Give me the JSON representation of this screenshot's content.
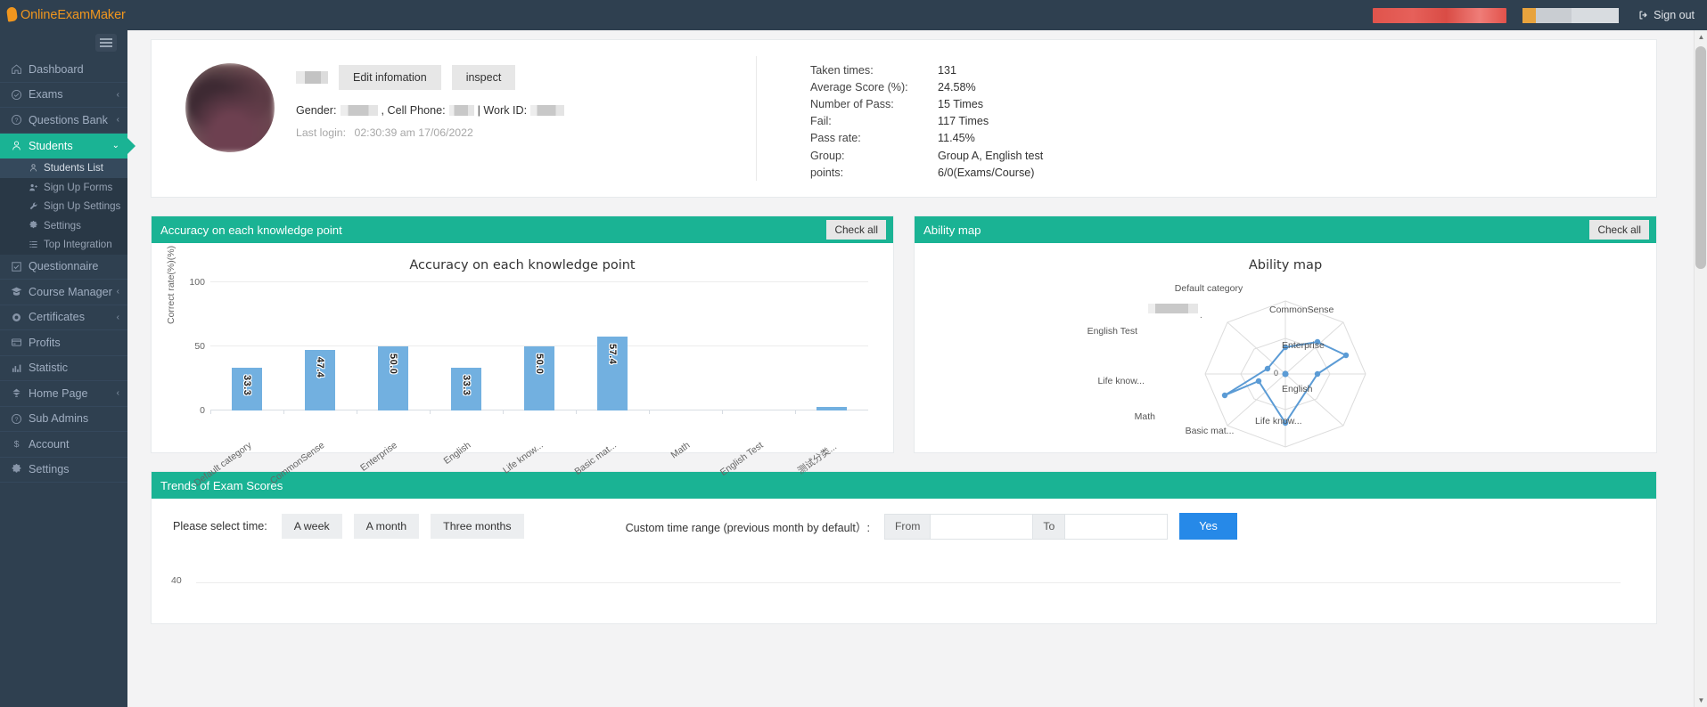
{
  "brand": {
    "name": "OnlineExamMaker"
  },
  "topbar": {
    "sign_out": "Sign out",
    "accent": "#f0961e"
  },
  "sidebar": {
    "items": [
      {
        "label": "Dashboard",
        "icon": "home-icon",
        "chevron": false,
        "active": false
      },
      {
        "label": "Exams",
        "icon": "check-circle-icon",
        "chevron": true,
        "active": false
      },
      {
        "label": "Questions Bank",
        "icon": "question-circle-icon",
        "chevron": true,
        "active": false
      },
      {
        "label": "Students",
        "icon": "user-icon",
        "chevron": true,
        "active": true
      },
      {
        "label": "Questionnaire",
        "icon": "checkbox-icon",
        "chevron": false,
        "active": false
      },
      {
        "label": "Course Manager",
        "icon": "graduation-cap-icon",
        "chevron": true,
        "active": false
      },
      {
        "label": "Certificates",
        "icon": "certificate-icon",
        "chevron": true,
        "active": false
      },
      {
        "label": "Profits",
        "icon": "card-icon",
        "chevron": false,
        "active": false
      },
      {
        "label": "Statistic",
        "icon": "bar-chart-icon",
        "chevron": false,
        "active": false
      },
      {
        "label": "Home Page",
        "icon": "leaf-icon",
        "chevron": true,
        "active": false
      },
      {
        "label": "Sub Admins",
        "icon": "question-circle-icon",
        "chevron": false,
        "active": false
      },
      {
        "label": "Account",
        "icon": "dollar-icon",
        "chevron": false,
        "active": false
      },
      {
        "label": "Settings",
        "icon": "gear-icon",
        "chevron": false,
        "active": false
      }
    ],
    "students_sub": [
      {
        "label": "Students List",
        "icon": "user-icon",
        "active": true
      },
      {
        "label": "Sign Up Forms",
        "icon": "user-plus-icon",
        "active": false
      },
      {
        "label": "Sign Up Settings",
        "icon": "wrench-icon",
        "active": false
      },
      {
        "label": "Settings",
        "icon": "gear-icon",
        "active": false
      },
      {
        "label": "Top Integration",
        "icon": "list-icon",
        "active": false
      }
    ]
  },
  "profile": {
    "edit_button": "Edit infomation",
    "inspect_button": "inspect",
    "gender_label": "Gender:",
    "cell_phone_label": ", Cell Phone:",
    "work_id_label": "| Work ID:",
    "last_login_label": "Last login:",
    "last_login_value": "02:30:39 am 17/06/2022"
  },
  "stats": [
    {
      "label": "Taken times:",
      "value": "131"
    },
    {
      "label": "Average Score (%):",
      "value": "24.58%"
    },
    {
      "label": "Number of Pass:",
      "value": "15 Times"
    },
    {
      "label": "Fail:",
      "value": "117 Times"
    },
    {
      "label": "Pass rate:",
      "value": "11.45%"
    },
    {
      "label": "Group:",
      "value": "Group A,   English test"
    },
    {
      "label": "points:",
      "value": "6/0(Exams/Course)"
    }
  ],
  "accuracy_panel": {
    "header": "Accuracy on each knowledge point",
    "check_all": "Check all"
  },
  "ability_panel": {
    "header": "Ability map",
    "check_all": "Check all"
  },
  "trends_panel": {
    "header": "Trends of Exam Scores",
    "select_time_label": "Please select time:",
    "week_button": "A week",
    "month_button": "A month",
    "three_months_button": "Three months",
    "custom_range_label": "Custom time range (previous month by default）:",
    "from_label": "From",
    "to_label": "To",
    "from_value": "",
    "to_value": "",
    "yes_button": "Yes",
    "y_tick": "40"
  },
  "colors": {
    "brand_green": "#1ab394",
    "sidebar": "#2f4050",
    "bar_blue": "#72b0e0",
    "primary_blue": "#2689e8",
    "orange": "#f0961e"
  },
  "chart_data": [
    {
      "type": "bar",
      "title": "Accuracy on each knowledge point",
      "xlabel": "",
      "ylabel": "Correct rate(%)(%)",
      "categories": [
        "Default category",
        "CommonSense",
        "Enterprise",
        "English",
        "Life know...",
        "Basic mat...",
        "Math",
        "English Test",
        "测试分类..."
      ],
      "values": [
        33.3,
        47.4,
        50.0,
        33.3,
        50.0,
        57.4,
        0,
        0,
        1.5
      ],
      "value_labels": [
        "33.3",
        "47.4",
        "50.0",
        "33.3",
        "50.0",
        "57.4",
        "",
        "",
        ""
      ],
      "ylim": [
        0,
        100
      ],
      "yticks": [
        0,
        50,
        100
      ],
      "grid": true,
      "legend": "none"
    },
    {
      "type": "radar",
      "title": "Ability map",
      "axes": [
        "Default category",
        "CommonSense",
        "Enterprise",
        "English",
        "Life know...",
        "Basic mat...",
        "Math",
        "Life know...",
        "English Test"
      ],
      "values": [
        30,
        55,
        60,
        58,
        35,
        52,
        28,
        40,
        15
      ],
      "center_tick": "0",
      "series_color": "#5b9bd5"
    },
    {
      "type": "line",
      "title": "Trends of Exam Scores",
      "yticks": [
        40
      ],
      "x": [],
      "values": []
    }
  ]
}
